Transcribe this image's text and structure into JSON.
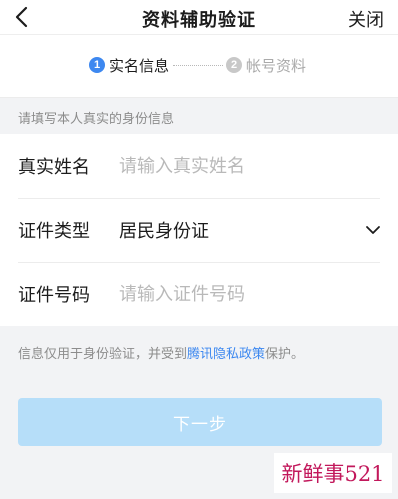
{
  "header": {
    "title": "资料辅助验证",
    "close_label": "关闭",
    "back_icon": "chevron-left-icon"
  },
  "steps": [
    {
      "number": "1",
      "label": "实名信息",
      "active": true
    },
    {
      "number": "2",
      "label": "帐号资料",
      "active": false
    }
  ],
  "section_hint": "请填写本人真实的身份信息",
  "form": {
    "name": {
      "label": "真实姓名",
      "placeholder": "请输入真实姓名",
      "value": ""
    },
    "id_type": {
      "label": "证件类型",
      "value": "居民身份证",
      "icon": "chevron-down-icon"
    },
    "id_number": {
      "label": "证件号码",
      "placeholder": "请输入证件号码",
      "value": ""
    }
  },
  "notice": {
    "prefix": "信息仅用于身份验证，并受到",
    "link": "腾讯隐私政策",
    "suffix": "保护。"
  },
  "next_button": "下一步",
  "watermark": "新鲜事521",
  "colors": {
    "accent": "#3d88f0",
    "button_disabled": "#b6def9",
    "step_inactive": "#c8c8c8",
    "watermark": "#c2185b"
  }
}
